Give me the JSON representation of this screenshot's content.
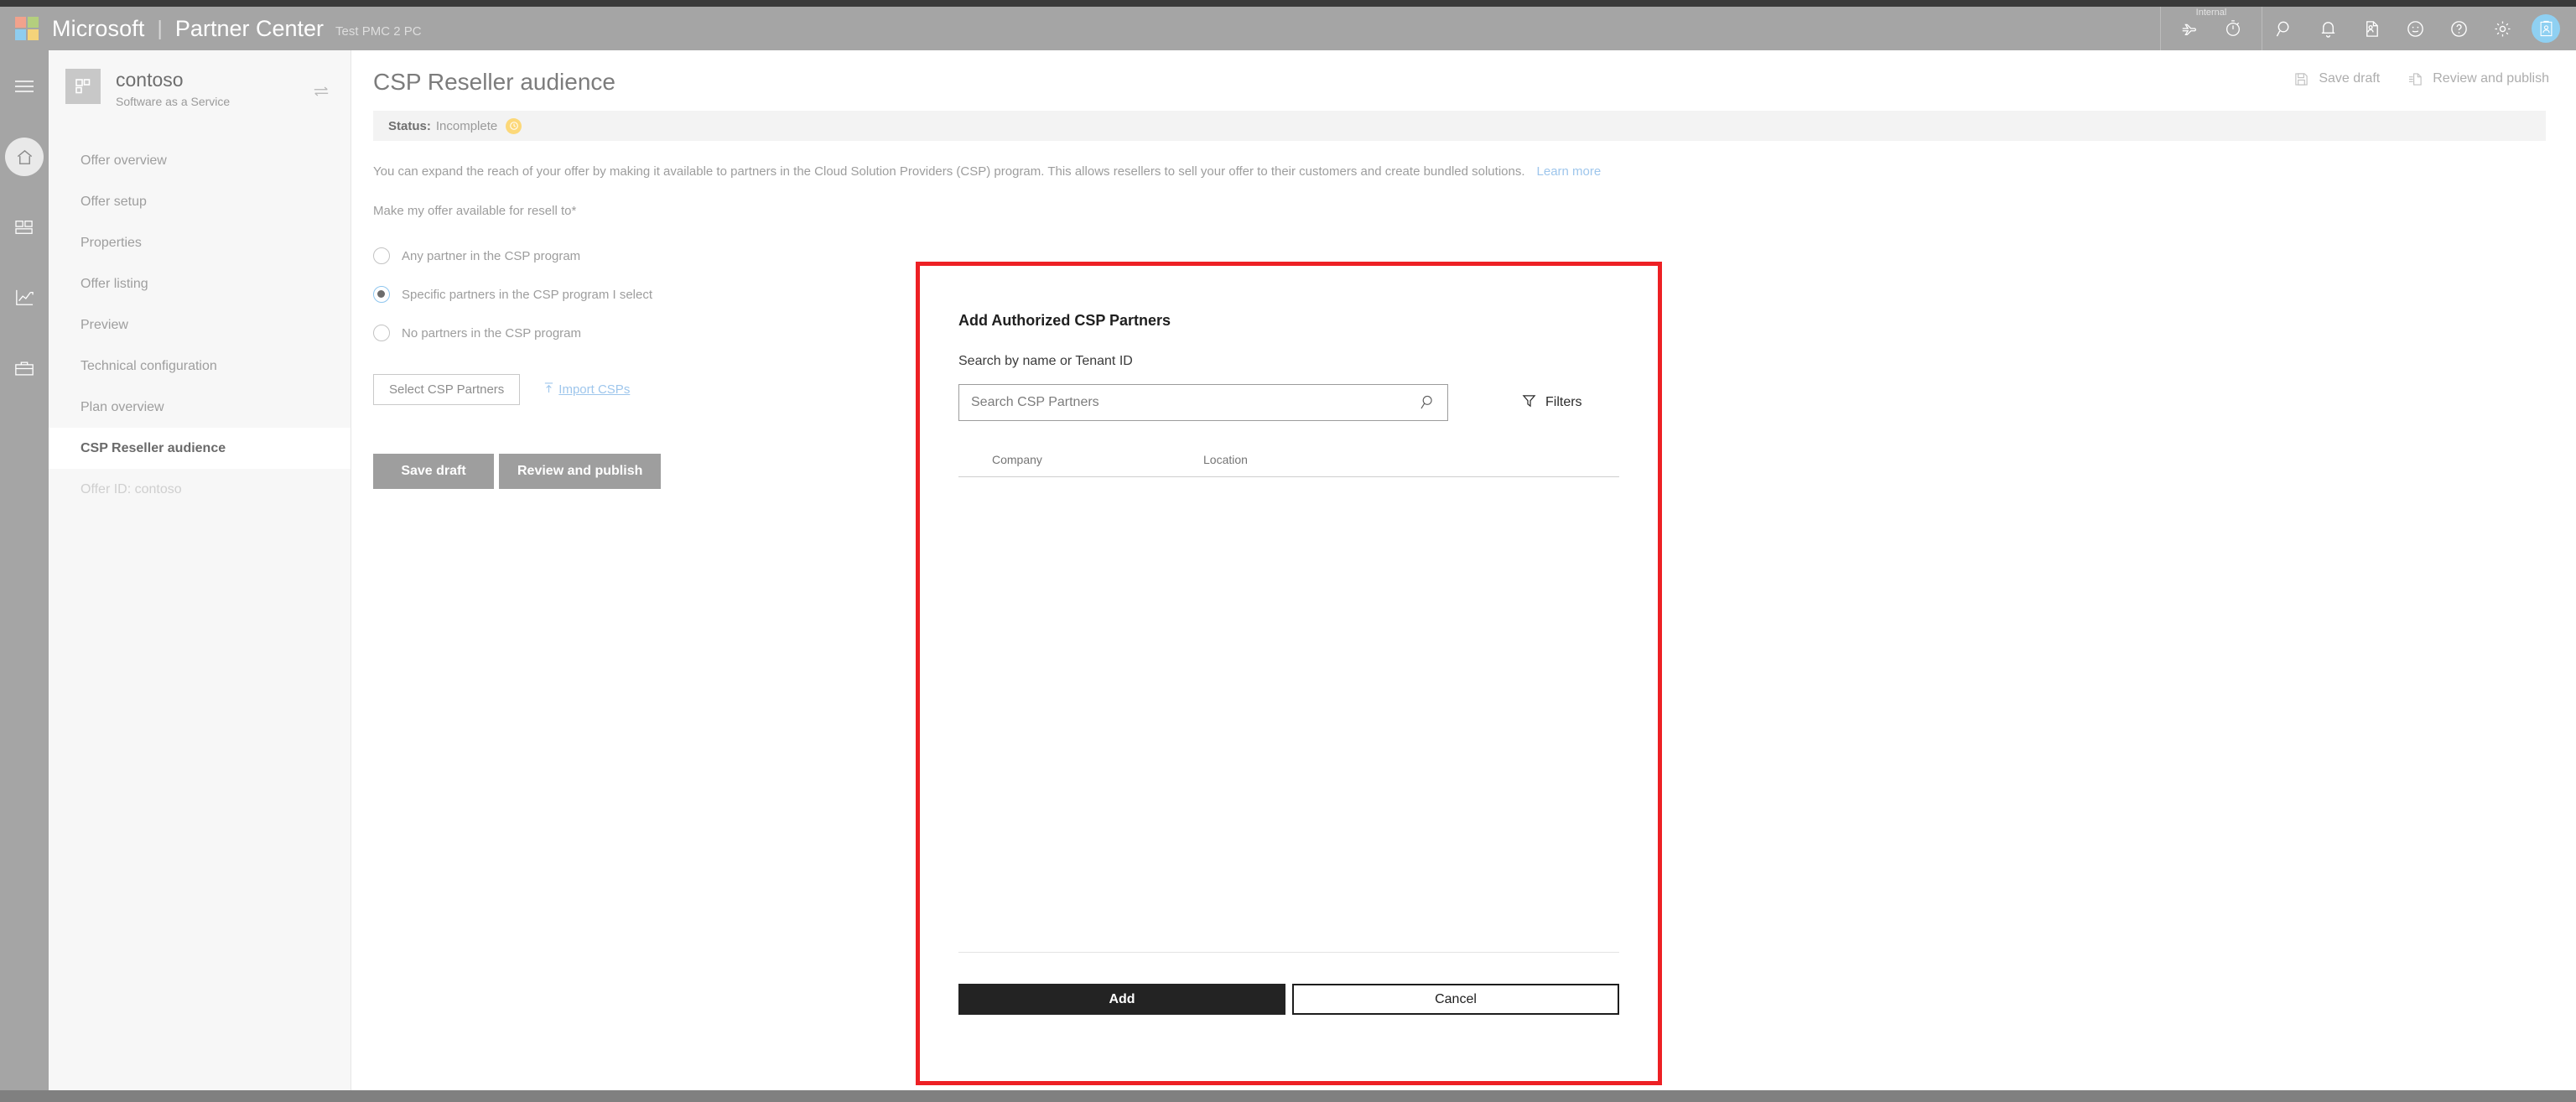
{
  "suitebar": {
    "brand_microsoft": "Microsoft",
    "brand_separator": "|",
    "brand_product": "Partner Center",
    "environment": "Test PMC 2 PC",
    "internal_label": "Internal",
    "icons": [
      {
        "name": "flight-icon",
        "title": "Flighting"
      },
      {
        "name": "timer-icon",
        "title": "Timer"
      },
      {
        "name": "search-icon",
        "title": "Search"
      },
      {
        "name": "bell-icon",
        "title": "Notifications"
      },
      {
        "name": "document-person-icon",
        "title": "Account"
      },
      {
        "name": "smiley-icon",
        "title": "Feedback"
      },
      {
        "name": "help-icon",
        "title": "Help"
      },
      {
        "name": "gear-icon",
        "title": "Settings"
      },
      {
        "name": "avatar-icon",
        "title": "Profile"
      }
    ]
  },
  "rail": {
    "items": [
      {
        "name": "hamburger-icon",
        "label": "Menu"
      },
      {
        "name": "home-icon",
        "label": "Home",
        "active": true
      },
      {
        "name": "dashboard-icon",
        "label": "Dashboard"
      },
      {
        "name": "analytics-icon",
        "label": "Analytics"
      },
      {
        "name": "briefcase-icon",
        "label": "Marketplace"
      }
    ]
  },
  "sidebar": {
    "offer": {
      "name": "contoso",
      "type": "Software as a Service",
      "thumb_icon": "offer-thumb-icon",
      "swap_icon": "swap-icon"
    },
    "items": [
      {
        "label": "Offer overview",
        "state": "normal"
      },
      {
        "label": "Offer setup",
        "state": "normal"
      },
      {
        "label": "Properties",
        "state": "normal"
      },
      {
        "label": "Offer listing",
        "state": "normal"
      },
      {
        "label": "Preview",
        "state": "normal"
      },
      {
        "label": "Technical configuration",
        "state": "normal"
      },
      {
        "label": "Plan overview",
        "state": "normal"
      },
      {
        "label": "CSP Reseller audience",
        "state": "active"
      },
      {
        "label": "Offer ID: contoso",
        "state": "muted"
      }
    ]
  },
  "page": {
    "title": "CSP Reseller audience",
    "header_actions": [
      {
        "label": "Save draft",
        "icon": "save-icon"
      },
      {
        "label": "Review and publish",
        "icon": "publish-icon"
      }
    ],
    "status": {
      "label": "Status:",
      "value": "Incomplete",
      "badge_icon": "clock-icon",
      "badge_color": "#fcd879"
    },
    "intro_text": "You can expand the reach of your offer by making it available to partners in the Cloud Solution Providers (CSP) program. This allows resellers to sell your offer to their customers and create bundled solutions.",
    "intro_link": "Learn more",
    "field_label": "Make my offer available for resell to*",
    "radio_options": [
      {
        "label": "Any partner in the CSP program",
        "checked": false
      },
      {
        "label": "Specific partners in the CSP program I select",
        "checked": true
      },
      {
        "label": "No partners in the CSP program",
        "checked": false
      }
    ],
    "select_csp_button": "Select CSP Partners",
    "import_link": "Import CSPs",
    "import_icon": "upload-icon",
    "footer_buttons": [
      {
        "label": "Save draft"
      },
      {
        "label": "Review and publish"
      }
    ]
  },
  "modal": {
    "annotation_color": "#ed2024",
    "title": "Add Authorized CSP Partners",
    "search_label": "Search by name or Tenant ID",
    "search_placeholder": "Search CSP Partners",
    "search_value": "",
    "search_icon": "magnifier-icon",
    "filters_label": "Filters",
    "filters_icon": "funnel-icon",
    "table": {
      "columns": [
        "Company",
        "Location"
      ],
      "rows": []
    },
    "primary_button": "Add",
    "secondary_button": "Cancel"
  }
}
